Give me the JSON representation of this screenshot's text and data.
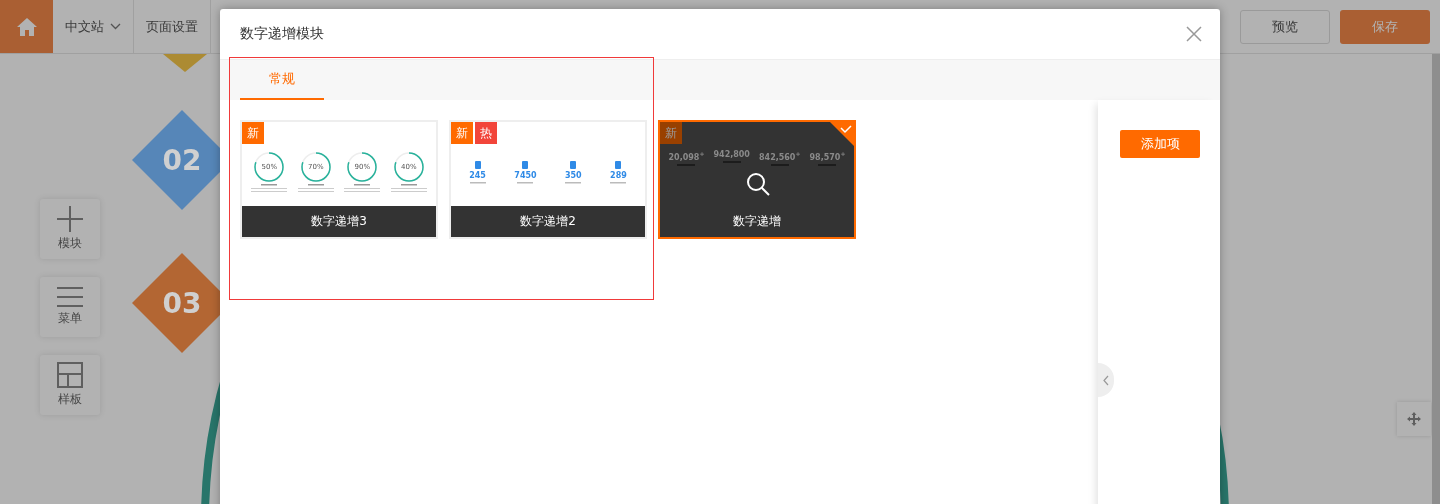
{
  "topbar": {
    "site_menu": "中文站",
    "page_settings": "页面设置",
    "preview_button": "预览",
    "save_button": "保存"
  },
  "tools": [
    {
      "kind": "plus",
      "label": "模块"
    },
    {
      "kind": "menu",
      "label": "菜单"
    },
    {
      "kind": "layout",
      "label": "样板"
    }
  ],
  "canvas": {
    "diamonds": [
      {
        "label": "02",
        "color": "#5686b8"
      },
      {
        "label": "03",
        "color": "#b36633"
      }
    ]
  },
  "dialog": {
    "title": "数字递增模块",
    "tabs": [
      {
        "label": "常规",
        "selected": true
      }
    ],
    "cards": [
      {
        "name": "数字递增3",
        "selected": false,
        "badges": [
          {
            "kind": "new",
            "label": "新"
          }
        ],
        "thumbnail": {
          "kind": "rings",
          "items": [
            {
              "label": "50%"
            },
            {
              "label": "70%"
            },
            {
              "label": "90%"
            },
            {
              "label": "40%"
            }
          ]
        }
      },
      {
        "name": "数字递增2",
        "selected": false,
        "badges": [
          {
            "kind": "new",
            "label": "新"
          },
          {
            "kind": "hot",
            "label": "热"
          }
        ],
        "thumbnail": {
          "kind": "icons",
          "items": [
            {
              "label": "245"
            },
            {
              "label": "7450"
            },
            {
              "label": "350"
            },
            {
              "label": "289"
            }
          ]
        }
      },
      {
        "name": "数字递增",
        "selected": true,
        "badges": [
          {
            "kind": "new",
            "label": "新"
          }
        ],
        "thumbnail": {
          "kind": "numbers",
          "items": [
            {
              "label": "20,098$^{+}$"
            },
            {
              "label": "942,800"
            },
            {
              "label": "842,560$^{+}$"
            },
            {
              "label": "98,570$^{+}$"
            }
          ]
        }
      }
    ],
    "add_button": "添加项"
  }
}
